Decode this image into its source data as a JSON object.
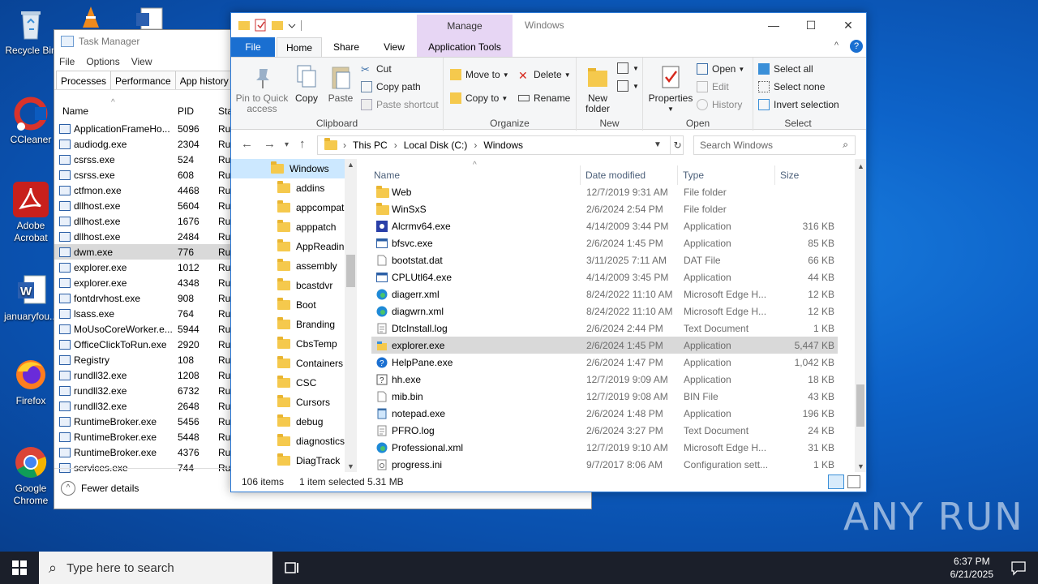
{
  "desktop": {
    "icons": [
      {
        "label": "Recycle Bin",
        "icon": "recycle-bin-icon"
      },
      {
        "label": "CCleaner",
        "icon": "ccleaner-icon"
      },
      {
        "label": "Adobe Acrobat",
        "icon": "adobe-acrobat-icon"
      },
      {
        "label": "januaryfou...",
        "icon": "word-document-icon"
      },
      {
        "label": "Firefox",
        "icon": "firefox-icon"
      },
      {
        "label": "Google Chrome",
        "icon": "chrome-icon"
      }
    ],
    "watermark": "ANY RUN"
  },
  "task_manager": {
    "title": "Task Manager",
    "menu": [
      "File",
      "Options",
      "View"
    ],
    "tabs": [
      "Processes",
      "Performance",
      "App history"
    ],
    "columns": {
      "name": "Name",
      "pid": "PID",
      "status": "Sta"
    },
    "rows": [
      {
        "name": "ApplicationFrameHo...",
        "pid": "5096",
        "status": "Ru"
      },
      {
        "name": "audiodg.exe",
        "pid": "2304",
        "status": "Ru"
      },
      {
        "name": "csrss.exe",
        "pid": "524",
        "status": "Ru"
      },
      {
        "name": "csrss.exe",
        "pid": "608",
        "status": "Ru"
      },
      {
        "name": "ctfmon.exe",
        "pid": "4468",
        "status": "Ru"
      },
      {
        "name": "dllhost.exe",
        "pid": "5604",
        "status": "Ru"
      },
      {
        "name": "dllhost.exe",
        "pid": "1676",
        "status": "Ru"
      },
      {
        "name": "dllhost.exe",
        "pid": "2484",
        "status": "Ru"
      },
      {
        "name": "dwm.exe",
        "pid": "776",
        "status": "Ru"
      },
      {
        "name": "explorer.exe",
        "pid": "1012",
        "status": "Ru"
      },
      {
        "name": "explorer.exe",
        "pid": "4348",
        "status": "Ru"
      },
      {
        "name": "fontdrvhost.exe",
        "pid": "908",
        "status": "Ru"
      },
      {
        "name": "lsass.exe",
        "pid": "764",
        "status": "Ru"
      },
      {
        "name": "MoUsoCoreWorker.e...",
        "pid": "5944",
        "status": "Ru"
      },
      {
        "name": "OfficeClickToRun.exe",
        "pid": "2920",
        "status": "Ru"
      },
      {
        "name": "Registry",
        "pid": "108",
        "status": "Ru"
      },
      {
        "name": "rundll32.exe",
        "pid": "1208",
        "status": "Ru"
      },
      {
        "name": "rundll32.exe",
        "pid": "6732",
        "status": "Ru"
      },
      {
        "name": "rundll32.exe",
        "pid": "2648",
        "status": "Ru"
      },
      {
        "name": "RuntimeBroker.exe",
        "pid": "5456",
        "status": "Ru"
      },
      {
        "name": "RuntimeBroker.exe",
        "pid": "5448",
        "status": "Ru"
      },
      {
        "name": "RuntimeBroker.exe",
        "pid": "4376",
        "status": "Ru"
      },
      {
        "name": "services.exe",
        "pid": "744",
        "status": "Ru"
      }
    ],
    "selected_row": "dwm.exe",
    "fewer_details": "Fewer details"
  },
  "explorer": {
    "window_title": "Windows",
    "manage_label": "Manage",
    "tabs": {
      "file": "File",
      "home": "Home",
      "share": "Share",
      "view": "View",
      "app_tools": "Application Tools"
    },
    "ribbon": {
      "clipboard": {
        "label": "Clipboard",
        "pin": "Pin to Quick access",
        "copy": "Copy",
        "paste": "Paste",
        "cut": "Cut",
        "copy_path": "Copy path",
        "paste_shortcut": "Paste shortcut"
      },
      "organize": {
        "label": "Organize",
        "move_to": "Move to",
        "copy_to": "Copy to",
        "delete": "Delete",
        "rename": "Rename"
      },
      "new": {
        "label": "New",
        "new_folder": "New folder"
      },
      "open": {
        "label": "Open",
        "properties": "Properties",
        "open": "Open",
        "edit": "Edit",
        "history": "History"
      },
      "select": {
        "label": "Select",
        "select_all": "Select all",
        "select_none": "Select none",
        "invert": "Invert selection"
      }
    },
    "address": [
      "This PC",
      "Local Disk (C:)",
      "Windows"
    ],
    "search_placeholder": "Search Windows",
    "nav_folders": [
      "Windows",
      "addins",
      "appcompat",
      "apppatch",
      "AppReadine",
      "assembly",
      "bcastdvr",
      "Boot",
      "Branding",
      "CbsTemp",
      "Containers",
      "CSC",
      "Cursors",
      "debug",
      "diagnostics",
      "DiagTrack"
    ],
    "columns": {
      "name": "Name",
      "date": "Date modified",
      "type": "Type",
      "size": "Size"
    },
    "files": [
      {
        "name": "Web",
        "date": "12/7/2019 9:31 AM",
        "type": "File folder",
        "size": "",
        "icon": "folder-icon"
      },
      {
        "name": "WinSxS",
        "date": "2/6/2024 2:54 PM",
        "type": "File folder",
        "size": "",
        "icon": "folder-icon"
      },
      {
        "name": "Alcrmv64.exe",
        "date": "4/14/2009 3:44 PM",
        "type": "Application",
        "size": "316 KB",
        "icon": "app-special-icon"
      },
      {
        "name": "bfsvc.exe",
        "date": "2/6/2024 1:45 PM",
        "type": "Application",
        "size": "85 KB",
        "icon": "application-icon"
      },
      {
        "name": "bootstat.dat",
        "date": "3/11/2025 7:11 AM",
        "type": "DAT File",
        "size": "66 KB",
        "icon": "file-icon"
      },
      {
        "name": "CPLUtl64.exe",
        "date": "4/14/2009 3:45 PM",
        "type": "Application",
        "size": "44 KB",
        "icon": "application-icon"
      },
      {
        "name": "diagerr.xml",
        "date": "8/24/2022 11:10 AM",
        "type": "Microsoft Edge H...",
        "size": "12 KB",
        "icon": "edge-icon"
      },
      {
        "name": "diagwrn.xml",
        "date": "8/24/2022 11:10 AM",
        "type": "Microsoft Edge H...",
        "size": "12 KB",
        "icon": "edge-icon"
      },
      {
        "name": "DtcInstall.log",
        "date": "2/6/2024 2:44 PM",
        "type": "Text Document",
        "size": "1 KB",
        "icon": "text-file-icon"
      },
      {
        "name": "explorer.exe",
        "date": "2/6/2024 1:45 PM",
        "type": "Application",
        "size": "5,447 KB",
        "icon": "explorer-icon"
      },
      {
        "name": "HelpPane.exe",
        "date": "2/6/2024 1:47 PM",
        "type": "Application",
        "size": "1,042 KB",
        "icon": "help-icon"
      },
      {
        "name": "hh.exe",
        "date": "12/7/2019 9:09 AM",
        "type": "Application",
        "size": "18 KB",
        "icon": "help-file-icon"
      },
      {
        "name": "mib.bin",
        "date": "12/7/2019 9:08 AM",
        "type": "BIN File",
        "size": "43 KB",
        "icon": "file-icon"
      },
      {
        "name": "notepad.exe",
        "date": "2/6/2024 1:48 PM",
        "type": "Application",
        "size": "196 KB",
        "icon": "notepad-icon"
      },
      {
        "name": "PFRO.log",
        "date": "2/6/2024 3:27 PM",
        "type": "Text Document",
        "size": "24 KB",
        "icon": "text-file-icon"
      },
      {
        "name": "Professional.xml",
        "date": "12/7/2019 9:10 AM",
        "type": "Microsoft Edge H...",
        "size": "31 KB",
        "icon": "edge-icon"
      },
      {
        "name": "progress.ini",
        "date": "9/7/2017 8:06 AM",
        "type": "Configuration sett...",
        "size": "1 KB",
        "icon": "config-file-icon"
      }
    ],
    "selected_file": "explorer.exe",
    "status": {
      "items": "106 items",
      "selected": "1 item selected",
      "size": "5.31 MB"
    }
  },
  "taskbar": {
    "search_placeholder": "Type here to search",
    "time": "6:37 PM",
    "date": "6/21/2025"
  }
}
